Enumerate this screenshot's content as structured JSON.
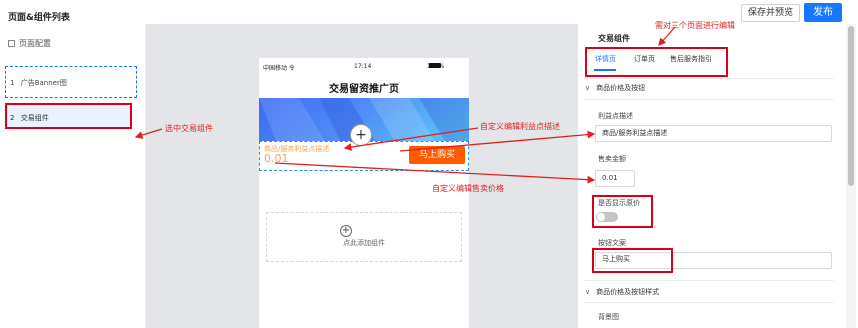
{
  "toolbar": {
    "preview_label": "保存并预览",
    "publish_label": "发布"
  },
  "left_panel": {
    "title": "页面&组件列表",
    "page_config": "页面配置",
    "components": [
      {
        "index": "1",
        "label": "广告Banner图"
      },
      {
        "index": "2",
        "label": "交易组件"
      }
    ]
  },
  "phone": {
    "carrier": "中国移动 令",
    "time": "17:14",
    "battery": "100%",
    "title": "交易留资推广页",
    "trade_desc": "商品/服务利益点描述",
    "price": "0.01",
    "buy_button": "马上购买",
    "add_component": "点此添加组件"
  },
  "right_panel": {
    "title": "交易组件",
    "tabs": [
      "详情页",
      "订单页",
      "售后服务指引"
    ],
    "section1": "商品价格及按钮",
    "field_benefit_label": "利益点描述",
    "field_benefit_value": "商品/服务利益点描述",
    "field_price_label": "售卖金额",
    "field_price_value": "0.01",
    "field_original_label": "是否显示原价",
    "field_button_label": "按钮文案",
    "field_button_value": "马上购买",
    "section2": "商品价格及按钮样式",
    "bg_label": "背景图"
  },
  "annotations": {
    "select_trade": "选中交易组件",
    "custom_benefit": "自定义编辑利益点描述",
    "custom_price": "自定义编辑售卖价格",
    "three_pages": "需对三个页面进行编辑"
  },
  "colors": {
    "accent": "#1677ff",
    "annotation": "#e02020",
    "buy": "#ff5a00",
    "price": "#f7a44c"
  }
}
